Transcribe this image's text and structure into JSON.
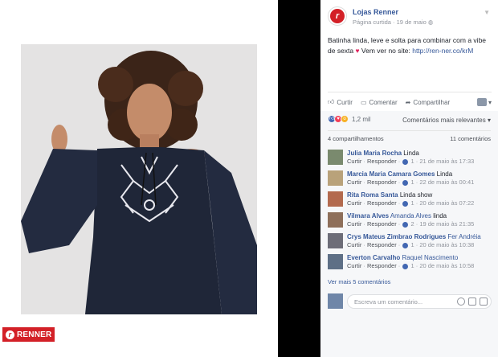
{
  "brand": {
    "logo_text": "RENNER"
  },
  "post": {
    "page_name": "Lojas Renner",
    "meta_visibility": "Página curtida",
    "meta_date": "19 de maio",
    "text_before_heart": "Batinha linda, leve e solta para combinar com a vibe de sexta ",
    "text_after_heart": " Vem ver no site: ",
    "link": "http://ren-ner.co/krM"
  },
  "actions": {
    "like": "Curtir",
    "comment": "Comentar",
    "share": "Compartilhar"
  },
  "stats": {
    "reaction_count": "1,2 mil",
    "sort_label": "Comentários mais relevantes",
    "shares": "4 compartilhamentos",
    "comments_count": "11 comentários"
  },
  "comments": [
    {
      "author": "Julia Maria Rocha",
      "tag": "",
      "text": "Linda",
      "likes": "1",
      "time": "21 de maio às 17:33",
      "avatar_color": "#7a8a6e"
    },
    {
      "author": "Marcia Maria Camara Gomes",
      "tag": "",
      "text": "Linda",
      "likes": "1",
      "time": "22 de maio às 00:41",
      "avatar_color": "#b9a27a"
    },
    {
      "author": "Rita Roma Santa",
      "tag": "",
      "text": "Linda show",
      "likes": "1",
      "time": "20 de maio às 07:22",
      "avatar_color": "#b36a4e"
    },
    {
      "author": "Vilmara Alves",
      "tag": "Amanda Alves",
      "text": "linda",
      "likes": "2",
      "time": "19 de maio às 21:35",
      "avatar_color": "#8e6f5a"
    },
    {
      "author": "Crys Mateus Zimbrao Rodrigues",
      "tag": "Fer Andréia",
      "text": "",
      "likes": "1",
      "time": "20 de maio às 10:38",
      "avatar_color": "#6d6d78"
    },
    {
      "author": "Everton Carvalho",
      "tag": "Raquel Nascimento",
      "text": "",
      "likes": "1",
      "time": "20 de maio às 10:58",
      "avatar_color": "#5e6f86"
    }
  ],
  "comment_actions": {
    "like": "Curtir",
    "reply": "Responder"
  },
  "more_comments": "Ver mais 5 comentários",
  "write_placeholder": "Escreva um comentário...",
  "colors": {
    "brand_red": "#d32027",
    "fb_blue": "#365899"
  }
}
